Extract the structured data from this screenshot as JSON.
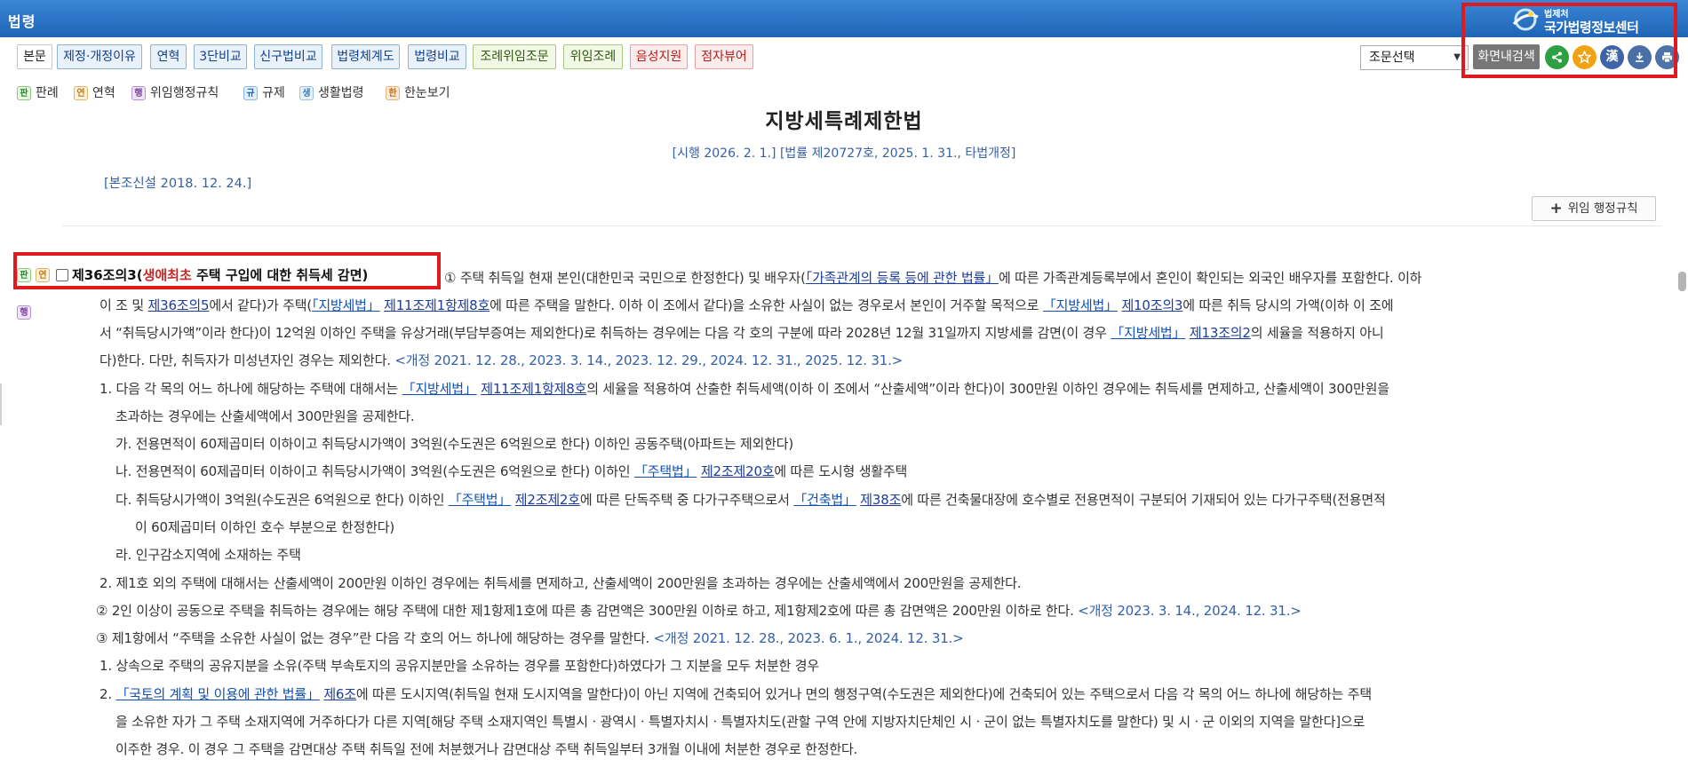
{
  "header": {
    "title": "법령",
    "logo_small": "법제처",
    "logo_name": "국가법령정보센터"
  },
  "toolbar": {
    "buttons": [
      "본문",
      "제정·개정이유",
      "연혁",
      "3단비교",
      "신구법비교",
      "법령체계도",
      "법령비교",
      "조례위임조문",
      "위임조례",
      "음성지원",
      "점자뷰어"
    ],
    "select_value": "조문선택",
    "search_label": "화면내검색",
    "hanja_label": "漢"
  },
  "legend": {
    "items": [
      {
        "tag": "판",
        "label": "판례"
      },
      {
        "tag": "연",
        "label": "연혁"
      },
      {
        "tag": "행",
        "label": "위임행정규칙"
      },
      {
        "tag": "규",
        "label": "규제"
      },
      {
        "tag": "생",
        "label": "생활법령"
      },
      {
        "tag": "한",
        "label": "한눈보기"
      }
    ]
  },
  "law": {
    "title": "지방세특례제한법",
    "subtitle": "[시행 2026. 2. 1.] [법률 제20727호, 2025. 1. 31., 타법개정]",
    "bonjo": "[본조신설 2018. 12. 24.]",
    "rule_button": "위임 행정규칙"
  },
  "article": {
    "tag_pan": "판",
    "tag_yeon": "연",
    "tag_haeng": "행",
    "number": "제36조의3(",
    "number_red": "생애최초",
    "number_rest": " 주택 구입에 대한 취득세 감면)",
    "l1_a": "① 주택 취득일 현재 본인(대한민국 국민으로 한정한다) 및 배우자(",
    "l1_link": "「가족관계의 등록 등에 관한 법률」",
    "l1_b": "에 따른 가족관계등록부에서 혼인이 확인되는 외국인 배우자를 포함한다. 이하",
    "l2_a": "이 조 및 ",
    "l2_link1": "제36조의5",
    "l2_b": "에서 같다)가 주택(",
    "l2_link2": "「지방세법」",
    "l2_c": " ",
    "l2_link3": "제11조",
    "l2_link4": "제1항",
    "l2_link5": "제8호",
    "l2_d": "에 따른 주택을 말한다. 이하 이 조에서 같다)을 소유한 사실이 없는 경우로서 본인이 거주할 목적으로 ",
    "l2_link6": "「지방세법」",
    "l2_e": " ",
    "l2_link7": "제10조의3",
    "l2_f": "에 따른 취득 당시의 가액(이하 이 조에",
    "l3_a": "서 “취득당시가액”이라 한다)이 12억원 이하인 주택을 유상거래(부담부증여는 제외한다)로 취득하는 경우에는 다음 각 호의 구분에 따라 2028년 12월 31일까지 지방세를 감면(이 경우 ",
    "l3_link1": "「지방세법」",
    "l3_b": " ",
    "l3_link2": "제13조의2",
    "l3_c": "의 세율을 적용하지 아니",
    "l4_a": "다)한다. 다만, 취득자가 미성년자인 경우는 제외한다. ",
    "l4_rev": "<개정 2021. 12. 28., 2023. 3. 14., 2023. 12. 29., 2024. 12. 31., 2025. 12. 31.>",
    "l5_a": "1. 다음 각 목의 어느 하나에 해당하는 주택에 대해서는 ",
    "l5_link1": "「지방세법」",
    "l5_b": " ",
    "l5_link2": "제11조",
    "l5_link3": "제1항",
    "l5_link4": "제8호",
    "l5_c": "의 세율을 적용하여 산출한 취득세액(이하 이 조에서 “산출세액”이라 한다)이 300만원 이하인 경우에는 취득세를 면제하고, 산출세액이 300만원을",
    "l6": "초과하는 경우에는 산출세액에서 300만원을 공제한다.",
    "l7": "가. 전용면적이 60제곱미터 이하이고 취득당시가액이 3억원(수도권은 6억원으로 한다) 이하인 공동주택(아파트는 제외한다)",
    "l8_a": "나. 전용면적이 60제곱미터 이하이고 취득당시가액이 3억원(수도권은 6억원으로 한다) 이하인 ",
    "l8_link1": "「주택법」",
    "l8_b": " ",
    "l8_link2": "제2조",
    "l8_link3": "제20호",
    "l8_c": "에 따른 도시형 생활주택",
    "l9_a": "다. 취득당시가액이 3억원(수도권은 6억원으로 한다) 이하인 ",
    "l9_link1": "「주택법」",
    "l9_b": " ",
    "l9_link2": "제2조",
    "l9_link3": "제2호",
    "l9_c": "에 따른 단독주택 중 다가구주택으로서 ",
    "l9_link4": "「건축법」",
    "l9_d": " ",
    "l9_link5": "제38조",
    "l9_e": "에 따른 건축물대장에 호수별로 전용면적이 구분되어 기재되어 있는 다가구주택(전용면적",
    "l10": "이 60제곱미터 이하인 호수 부분으로 한정한다)",
    "l11": "라. 인구감소지역에 소재하는 주택",
    "l12": "2. 제1호 외의 주택에 대해서는 산출세액이 200만원 이하인 경우에는 취득세를 면제하고, 산출세액이 200만원을 초과하는 경우에는 산출세액에서 200만원을 공제한다.",
    "l13_a": "② 2인 이상이 공동으로 주택을 취득하는 경우에는 해당 주택에 대한 제1항제1호에 따른 총 감면액은 300만원 이하로 하고, 제1항제2호에 따른 총 감면액은 200만원 이하로 한다. ",
    "l13_rev": "<개정 2023. 3. 14., 2024. 12. 31.>",
    "l14_a": "③ 제1항에서 “주택을 소유한 사실이 없는 경우”란 다음 각 호의 어느 하나에 해당하는 경우를 말한다. ",
    "l14_rev": "<개정 2021. 12. 28., 2023. 6. 1., 2024. 12. 31.>",
    "l15": "1. 상속으로 주택의 공유지분을 소유(주택 부속토지의 공유지분만을 소유하는 경우를 포함한다)하였다가 그 지분을 모두 처분한 경우",
    "l16_a": "2. ",
    "l16_link1": "「국토의 계획 및 이용에 관한 법률」",
    "l16_b": " ",
    "l16_link2": "제6조",
    "l16_c": "에 따른 도시지역(취득일 현재 도시지역을 말한다)이 아닌 지역에 건축되어 있거나 면의 행정구역(수도권은 제외한다)에 건축되어 있는 주택으로서 다음 각 목의 어느 하나에 해당하는 주택",
    "l17": "을 소유한 자가 그 주택 소재지역에 거주하다가 다른 지역[해당 주택 소재지역인 특별시ㆍ광역시ㆍ특별자치시ㆍ특별자치도(관할 구역 안에 지방자치단체인 시ㆍ군이 없는 특별자치도를 말한다) 및 시ㆍ군 이외의 지역을 말한다]으로",
    "l18": "이주한 경우. 이 경우 그 주택을 감면대상 주택 취득일 전에 처분했거나 감면대상 주택 취득일부터 3개월 이내에 처분한 경우로 한정한다."
  },
  "colors": {
    "header_bg": "#2a74c7",
    "highlight_frame": "#e0191f",
    "link": "#1b3d9b",
    "revision": "#3560a8",
    "share": "#2e9f43",
    "favorite": "#f0a415",
    "hanja": "#3f63a6",
    "download": "#4a6fa5",
    "print": "#4e73ab"
  },
  "icons": {
    "share": "share-icon",
    "favorite": "star-icon",
    "download": "download-icon",
    "print": "print-icon"
  }
}
